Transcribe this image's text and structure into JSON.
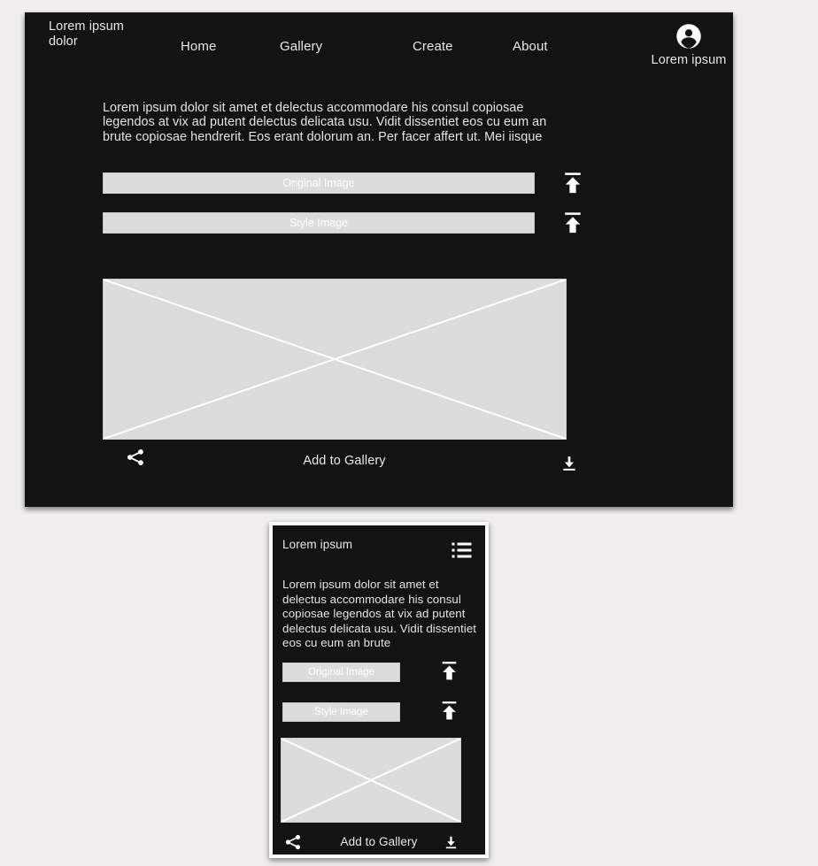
{
  "page": {
    "background_color": "#f0efed",
    "panel_background": "#131313",
    "text_color": "#e8e8e8",
    "placeholder_fill": "#dcdcdc"
  },
  "desktop": {
    "nav": {
      "brand": "Lorem ipsum dolor",
      "links": [
        {
          "label": "Home",
          "name": "nav-link-home"
        },
        {
          "label": "Gallery",
          "name": "nav-link-gallery"
        },
        {
          "label": "Create",
          "name": "nav-link-create"
        },
        {
          "label": "About",
          "name": "nav-link-about"
        }
      ],
      "account": {
        "icon": "account-circle-icon",
        "name": "Lorem ipsum"
      }
    },
    "intro_text": "Lorem ipsum dolor sit amet et delectus accommodare his consul copiosae legendos at vix ad putent delectus delicata usu. Vidit dissentiet eos cu eum an brute copiosae hendrerit. Eos erant dolorum an. Per facer affert ut. Mei iisque mentitum moderatius",
    "uploads": [
      {
        "label": "Original Image",
        "button_icon": "upload-icon"
      },
      {
        "label": "Style Image",
        "button_icon": "upload-icon"
      }
    ],
    "preview": {
      "name": "image-placeholder",
      "fill": "#dcdcdc",
      "cross_color": "#ffffff"
    },
    "actions": {
      "share_icon": "share-icon",
      "label": "Add to Gallery",
      "download_icon": "download-icon"
    }
  },
  "mobile": {
    "header": {
      "brand": "Lorem ipsum",
      "menu_icon": "list-menu-icon"
    },
    "intro_text": "Lorem ipsum dolor sit amet et delectus accommodare his consul copiosae legendos at vix ad putent delectus delicata usu. Vidit dissentiet eos cu eum an brute",
    "uploads": [
      {
        "label": "Original Image",
        "button_icon": "upload-icon"
      },
      {
        "label": "Style Image",
        "button_icon": "upload-icon"
      }
    ],
    "preview": {
      "name": "image-placeholder",
      "fill": "#dcdcdc",
      "cross_color": "#ffffff"
    },
    "actions": {
      "share_icon": "share-icon",
      "label": "Add to Gallery",
      "download_icon": "download-icon"
    }
  }
}
